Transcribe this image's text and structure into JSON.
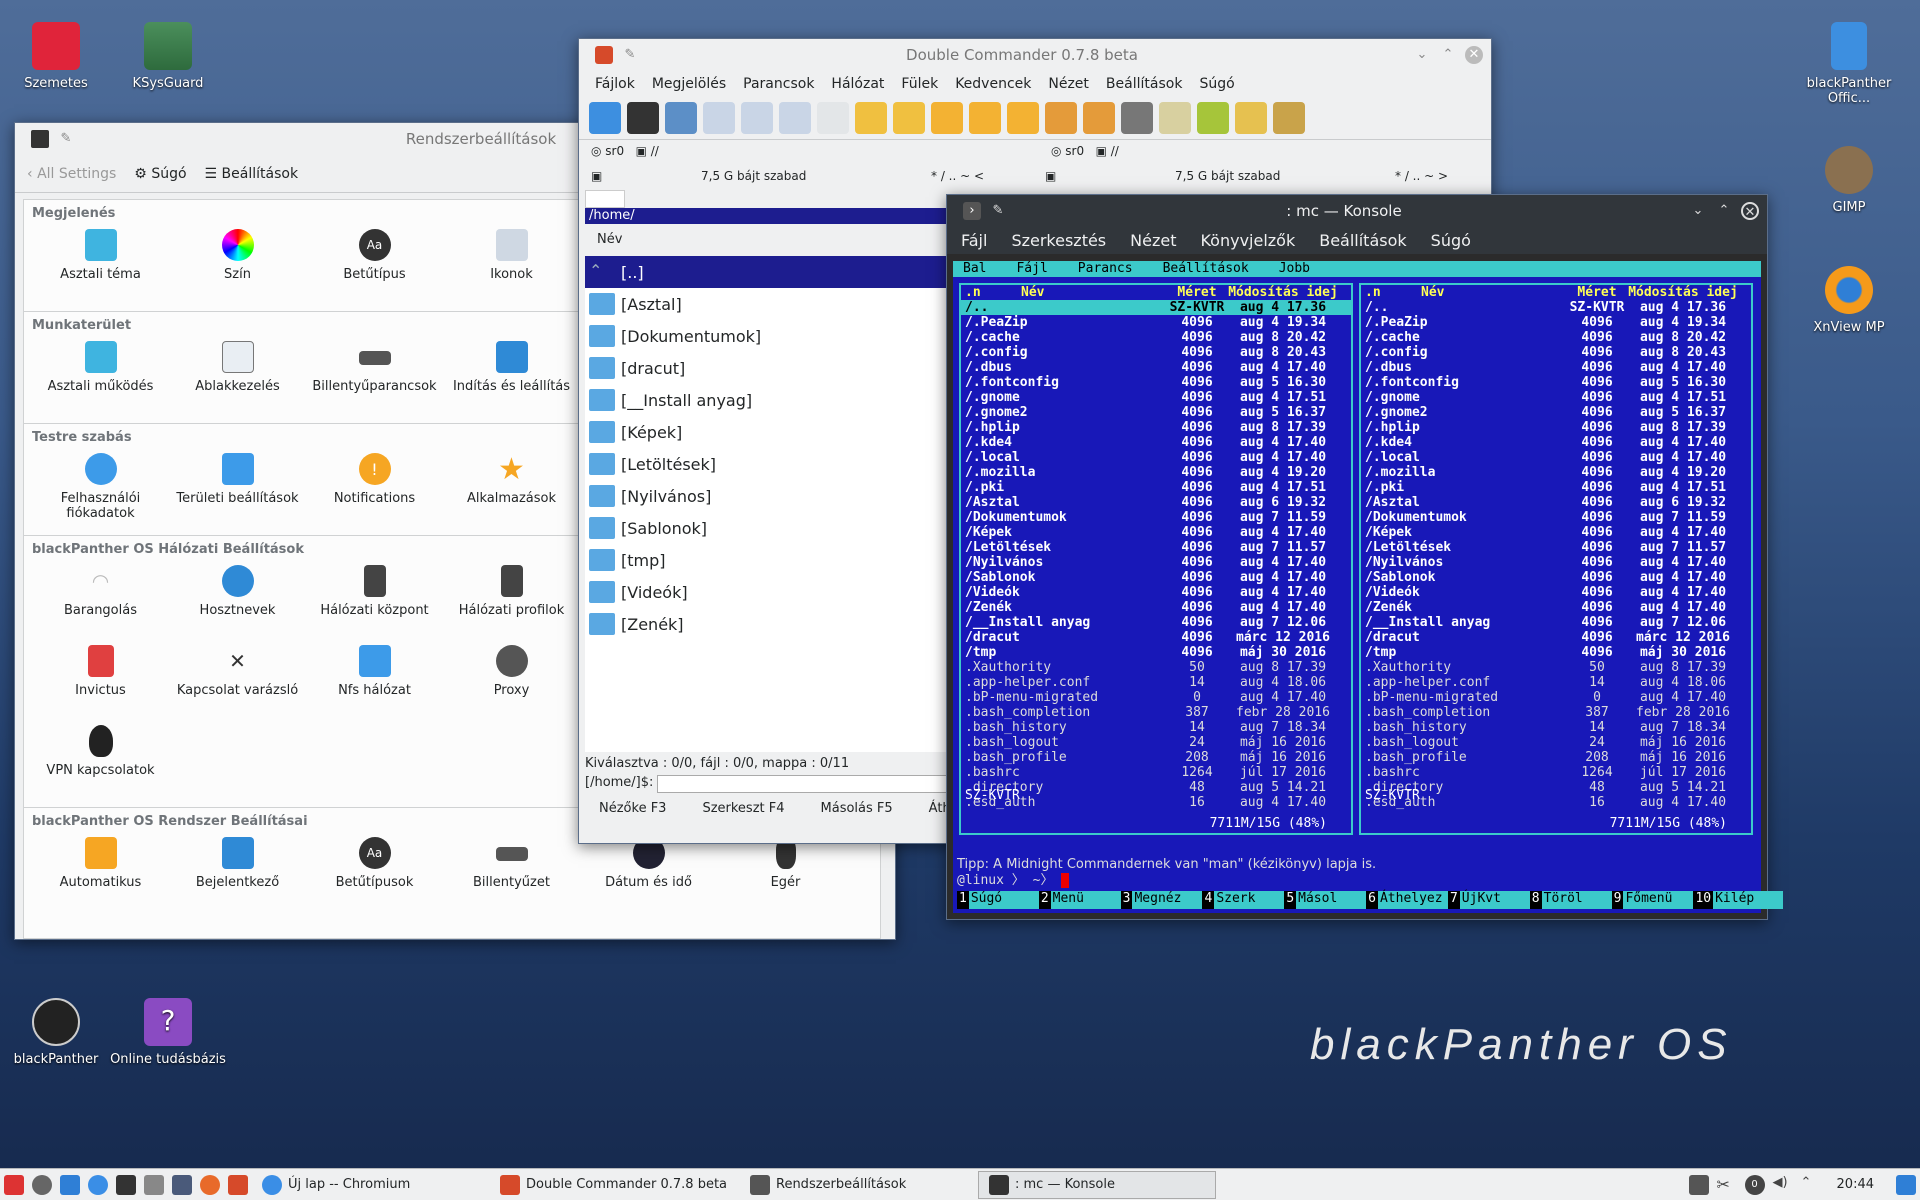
{
  "desktop": {
    "icons_left": [
      {
        "label": "Szemetes"
      },
      {
        "label": "KSysGuard"
      }
    ],
    "icons_right": [
      {
        "label": "blackPanther Offic..."
      },
      {
        "label": "GIMP"
      },
      {
        "label": "XnView MP"
      }
    ],
    "icons_bottom": [
      {
        "label": "blackPanther"
      },
      {
        "label": "Online tudásbázis"
      }
    ],
    "logo_text": "blackPanther OS"
  },
  "settings": {
    "title": "Rendszerbeállítások",
    "back_label": "All Settings",
    "help_label": "Súgó",
    "config_label": "Beállítások",
    "categories": [
      {
        "name": "Megjelenés",
        "items": [
          "Asztali téma",
          "Szín",
          "Betűtípus",
          "Ikonok"
        ]
      },
      {
        "name": "Munkaterület",
        "items": [
          "Asztali működés",
          "Ablakkezelés",
          "Billentyűparancsok",
          "Indítás és leállítás"
        ]
      },
      {
        "name": "Testre szabás",
        "items": [
          "Felhasználói fiókadatok",
          "Területi beállítások",
          "Notifications",
          "Alkalmazások"
        ]
      },
      {
        "name": "blackPanther OS Hálózati Beállítások",
        "items": [
          "Barangolás",
          "Hosztnevek",
          "Hálózati központ",
          "Hálózati profilok",
          "Invictus",
          "Kapcsolat varázsló",
          "Nfs hálózat",
          "Proxy",
          "VPN kapcsolatok"
        ]
      },
      {
        "name": "blackPanther OS Rendszer Beállításai",
        "items": [
          "Automatikus",
          "Bejelentkező",
          "Betűtípusok",
          "Billentyűzet",
          "Dátum és idő",
          "Egér"
        ]
      }
    ]
  },
  "dc": {
    "title": "Double Commander 0.7.8 beta",
    "menu": [
      "Fájlok",
      "Megjelölés",
      "Parancsok",
      "Hálózat",
      "Fülek",
      "Kedvencek",
      "Nézet",
      "Beállítások",
      "Súgó"
    ],
    "drive_left": "sr0",
    "drive_path": "//",
    "drive_right": "sr0",
    "free_left": "7,5 G bájt szabad",
    "free_right": "7,5 G bájt szabad",
    "nav_left": "* / .. ~ <",
    "nav_right": "* / .. ~ >",
    "path": "/home/",
    "col_name": "Név",
    "files": [
      "[..]",
      "[Asztal]",
      "[Dokumentumok]",
      "[dracut]",
      "[__Install anyag]",
      "[Képek]",
      "[Letöltések]",
      "[Nyilvános]",
      "[Sablonok]",
      "[tmp]",
      "[Videók]",
      "[Zenék]"
    ],
    "status": "Kiválasztva : 0/0, fájl : 0/0, mappa : 0/11",
    "cmd_prompt": "[/home/]$:",
    "fkeys": [
      "Nézőke F3",
      "Szerkeszt F4",
      "Másolás F5",
      "Áth"
    ]
  },
  "konsole": {
    "title": ": mc — Konsole",
    "menu": [
      "Fájl",
      "Szerkesztés",
      "Nézet",
      "Könyvjelzők",
      "Beállítások",
      "Súgó"
    ],
    "mc_menu": [
      "Bal",
      "Fájl",
      "Parancs",
      "Beállítások",
      "Jobb"
    ],
    "headers": {
      "n": ".n",
      "name": "Név",
      "size": "Méret",
      "date": "Módosítás idej"
    },
    "rows": [
      {
        "n": "/..",
        "s": "SZ-KVTR",
        "d": "aug  4 17.36",
        "b": true,
        "sel": true
      },
      {
        "n": "/.PeaZip",
        "s": "4096",
        "d": "aug  4 19.34",
        "b": true
      },
      {
        "n": "/.cache",
        "s": "4096",
        "d": "aug  8 20.42",
        "b": true
      },
      {
        "n": "/.config",
        "s": "4096",
        "d": "aug  8 20.43",
        "b": true
      },
      {
        "n": "/.dbus",
        "s": "4096",
        "d": "aug  4 17.40",
        "b": true
      },
      {
        "n": "/.fontconfig",
        "s": "4096",
        "d": "aug  5 16.30",
        "b": true
      },
      {
        "n": "/.gnome",
        "s": "4096",
        "d": "aug  4 17.51",
        "b": true
      },
      {
        "n": "/.gnome2",
        "s": "4096",
        "d": "aug  5 16.37",
        "b": true
      },
      {
        "n": "/.hplip",
        "s": "4096",
        "d": "aug  8 17.39",
        "b": true
      },
      {
        "n": "/.kde4",
        "s": "4096",
        "d": "aug  4 17.40",
        "b": true
      },
      {
        "n": "/.local",
        "s": "4096",
        "d": "aug  4 17.40",
        "b": true
      },
      {
        "n": "/.mozilla",
        "s": "4096",
        "d": "aug  4 19.20",
        "b": true
      },
      {
        "n": "/.pki",
        "s": "4096",
        "d": "aug  4 17.51",
        "b": true
      },
      {
        "n": "/Asztal",
        "s": "4096",
        "d": "aug  6 19.32",
        "b": true
      },
      {
        "n": "/Dokumentumok",
        "s": "4096",
        "d": "aug  7 11.59",
        "b": true
      },
      {
        "n": "/Képek",
        "s": "4096",
        "d": "aug  4 17.40",
        "b": true
      },
      {
        "n": "/Letöltések",
        "s": "4096",
        "d": "aug  7 11.57",
        "b": true
      },
      {
        "n": "/Nyilvános",
        "s": "4096",
        "d": "aug  4 17.40",
        "b": true
      },
      {
        "n": "/Sablonok",
        "s": "4096",
        "d": "aug  4 17.40",
        "b": true
      },
      {
        "n": "/Videók",
        "s": "4096",
        "d": "aug  4 17.40",
        "b": true
      },
      {
        "n": "/Zenék",
        "s": "4096",
        "d": "aug  4 17.40",
        "b": true
      },
      {
        "n": "/__Install anyag",
        "s": "4096",
        "d": "aug  7 12.06",
        "b": true
      },
      {
        "n": "/dracut",
        "s": "4096",
        "d": "márc 12  2016",
        "b": true
      },
      {
        "n": "/tmp",
        "s": "4096",
        "d": "máj 30  2016",
        "b": true
      },
      {
        "n": ".Xauthority",
        "s": "50",
        "d": "aug  8 17.39",
        "b": false
      },
      {
        "n": ".app-helper.conf",
        "s": "14",
        "d": "aug  4 18.06",
        "b": false
      },
      {
        "n": ".bP-menu-migrated",
        "s": "0",
        "d": "aug  4 17.40",
        "b": false
      },
      {
        "n": ".bash_completion",
        "s": "387",
        "d": "febr 28  2016",
        "b": false
      },
      {
        "n": ".bash_history",
        "s": "14",
        "d": "aug  7 18.34",
        "b": false
      },
      {
        "n": ".bash_logout",
        "s": "24",
        "d": "máj 16  2016",
        "b": false
      },
      {
        "n": ".bash_profile",
        "s": "208",
        "d": "máj 16  2016",
        "b": false
      },
      {
        "n": ".bashrc",
        "s": "1264",
        "d": "júl 17  2016",
        "b": false
      },
      {
        "n": ".directory",
        "s": "48",
        "d": "aug  5 14.21",
        "b": false
      },
      {
        "n": ".esd_auth",
        "s": "16",
        "d": "aug  4 17.40",
        "b": false
      }
    ],
    "footer_left": "SZ-KVTR",
    "footer_right": "SZ-KVTR",
    "usage": "7711M/15G (48%)",
    "tip": "Tipp: A Midnight Commandernek van \"man\" (kézikönyv) lapja is.",
    "prompt": "@linux  〉 ~〉",
    "fkeys": [
      {
        "n": "1",
        "l": "Súgó"
      },
      {
        "n": "2",
        "l": "Menü"
      },
      {
        "n": "3",
        "l": "Megnéz"
      },
      {
        "n": "4",
        "l": "Szerk"
      },
      {
        "n": "5",
        "l": "Másol"
      },
      {
        "n": "6",
        "l": "Áthelyez"
      },
      {
        "n": "7",
        "l": "ÚjKvt"
      },
      {
        "n": "8",
        "l": "Töröl"
      },
      {
        "n": "9",
        "l": "Főmenü"
      },
      {
        "n": "10",
        "l": "Kilép"
      }
    ]
  },
  "taskbar": {
    "tasks": [
      "Új lap -- Chromium",
      "Double Commander 0.7.8 beta",
      "Rendszerbeállítások",
      ": mc — Konsole"
    ],
    "clock": "20:44",
    "badge": "0"
  },
  "colors": {
    "accent": "#1d1d8f",
    "mc_bg": "#1818b8",
    "mc_cyan": "#3ccaca",
    "panel": "#eff0f1"
  }
}
